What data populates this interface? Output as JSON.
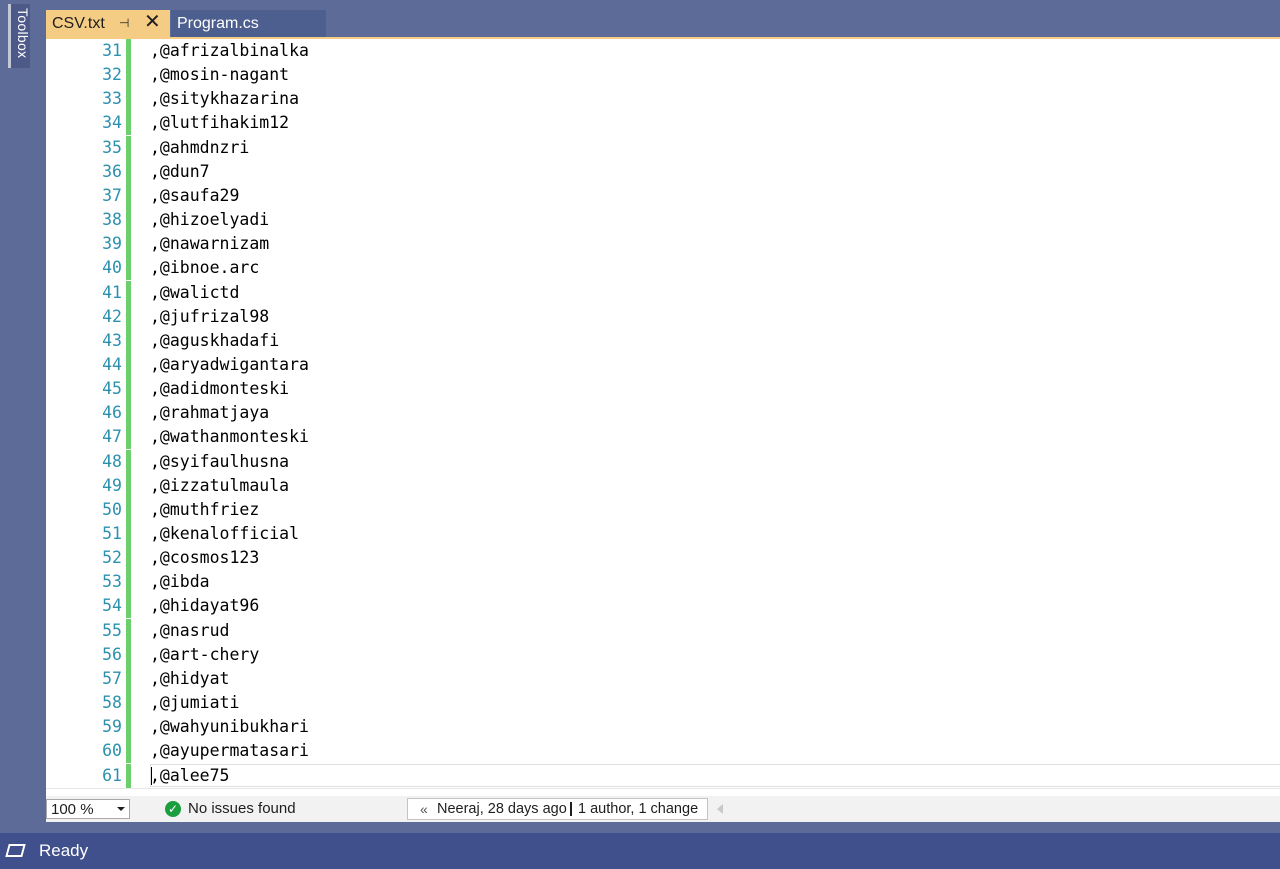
{
  "toolbox": {
    "label": "Toolbox"
  },
  "tabs": [
    {
      "title": "CSV.txt",
      "active": true
    },
    {
      "title": "Program.cs",
      "active": false
    }
  ],
  "icons": {
    "pin": "pin-icon",
    "close": "close-icon",
    "ready": "ready-icon",
    "issues": "check-circle-icon",
    "git": "git-history-icon"
  },
  "colors": {
    "active_tab": "#f5cc84",
    "line_number": "#2b91af",
    "change_bar": "#6ccf6c",
    "status_bar": "#40508d"
  },
  "editor": {
    "lines": [
      {
        "number": "31",
        "text": ",@afrizalbinalka"
      },
      {
        "number": "32",
        "text": ",@mosin-nagant"
      },
      {
        "number": "33",
        "text": ",@sitykhazarina"
      },
      {
        "number": "34",
        "text": ",@lutfihakim12"
      },
      {
        "number": "35",
        "text": ",@ahmdnzri"
      },
      {
        "number": "36",
        "text": ",@dun7"
      },
      {
        "number": "37",
        "text": ",@saufa29"
      },
      {
        "number": "38",
        "text": ",@hizoelyadi"
      },
      {
        "number": "39",
        "text": ",@nawarnizam"
      },
      {
        "number": "40",
        "text": ",@ibnoe.arc"
      },
      {
        "number": "41",
        "text": ",@walictd"
      },
      {
        "number": "42",
        "text": ",@jufrizal98"
      },
      {
        "number": "43",
        "text": ",@aguskhadafi"
      },
      {
        "number": "44",
        "text": ",@aryadwigantara"
      },
      {
        "number": "45",
        "text": ",@adidmonteski"
      },
      {
        "number": "46",
        "text": ",@rahmatjaya"
      },
      {
        "number": "47",
        "text": ",@wathanmonteski"
      },
      {
        "number": "48",
        "text": ",@syifaulhusna"
      },
      {
        "number": "49",
        "text": ",@izzatulmaula"
      },
      {
        "number": "50",
        "text": ",@muthfriez"
      },
      {
        "number": "51",
        "text": ",@kenalofficial"
      },
      {
        "number": "52",
        "text": ",@cosmos123"
      },
      {
        "number": "53",
        "text": ",@ibda"
      },
      {
        "number": "54",
        "text": ",@hidayat96"
      },
      {
        "number": "55",
        "text": ",@nasrud"
      },
      {
        "number": "56",
        "text": ",@art-chery"
      },
      {
        "number": "57",
        "text": ",@hidyat"
      },
      {
        "number": "58",
        "text": ",@jumiati"
      },
      {
        "number": "59",
        "text": ",@wahyunibukhari"
      },
      {
        "number": "60",
        "text": ",@ayupermatasari"
      },
      {
        "number": "61",
        "text": ",@alee75"
      }
    ]
  },
  "editor_status": {
    "zoom": "100 %",
    "issues": "No issues found",
    "git_author": "Neeraj, 28 days ago",
    "git_changes": "1 author, 1 change"
  },
  "statusbar": {
    "text": "Ready"
  }
}
